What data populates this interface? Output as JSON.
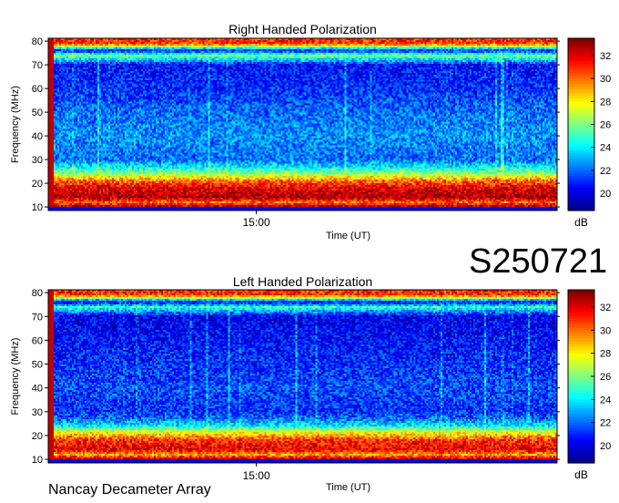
{
  "event_code": "S250721",
  "instrument": "Nancay Decameter Array",
  "colors": {
    "colormap": [
      "#00008f",
      "#0000ff",
      "#0080ff",
      "#00ffff",
      "#80ff80",
      "#ffff00",
      "#ff8000",
      "#ff0000",
      "#800000"
    ]
  },
  "chart_data": [
    {
      "type": "heatmap",
      "title": "Right Handed Polarization",
      "xlabel": "Time (UT)",
      "ylabel": "Frequency (MHz)",
      "x_ticks": [
        "15:00"
      ],
      "y_ticks": [
        10,
        20,
        30,
        40,
        50,
        60,
        70,
        80
      ],
      "ylim": [
        10,
        80
      ],
      "colorbar": {
        "label": "dB",
        "ticks": [
          20,
          22,
          24,
          26,
          28,
          30,
          32
        ],
        "range": [
          18.5,
          33.5
        ]
      },
      "background_level_db": 20.5,
      "frequency_profile_db": [
        {
          "f": 10,
          "db": 33
        },
        {
          "f": 12,
          "db": 30
        },
        {
          "f": 14,
          "db": 33
        },
        {
          "f": 18,
          "db": 32
        },
        {
          "f": 21,
          "db": 30
        },
        {
          "f": 24,
          "db": 26
        },
        {
          "f": 27,
          "db": 24
        },
        {
          "f": 30,
          "db": 22
        },
        {
          "f": 40,
          "db": 22.5
        },
        {
          "f": 50,
          "db": 22
        },
        {
          "f": 60,
          "db": 21
        },
        {
          "f": 70,
          "db": 20.5
        },
        {
          "f": 74,
          "db": 26
        },
        {
          "f": 76,
          "db": 20.5
        },
        {
          "f": 79,
          "db": 31
        }
      ]
    },
    {
      "type": "heatmap",
      "title": "Left Handed Polarization",
      "xlabel": "Time (UT)",
      "ylabel": "Frequency (MHz)",
      "x_ticks": [
        "15:00"
      ],
      "y_ticks": [
        10,
        20,
        30,
        40,
        50,
        60,
        70,
        80
      ],
      "ylim": [
        10,
        80
      ],
      "colorbar": {
        "label": "dB",
        "ticks": [
          20,
          22,
          24,
          26,
          28,
          30,
          32
        ],
        "range": [
          18.5,
          33.5
        ]
      },
      "background_level_db": 20.0,
      "frequency_profile_db": [
        {
          "f": 10,
          "db": 33
        },
        {
          "f": 12,
          "db": 29
        },
        {
          "f": 14,
          "db": 32
        },
        {
          "f": 18,
          "db": 31
        },
        {
          "f": 21,
          "db": 28
        },
        {
          "f": 24,
          "db": 24
        },
        {
          "f": 27,
          "db": 22
        },
        {
          "f": 30,
          "db": 21
        },
        {
          "f": 40,
          "db": 21.5
        },
        {
          "f": 50,
          "db": 21
        },
        {
          "f": 60,
          "db": 20.5
        },
        {
          "f": 70,
          "db": 20
        },
        {
          "f": 74,
          "db": 25
        },
        {
          "f": 76,
          "db": 20
        },
        {
          "f": 79,
          "db": 31
        }
      ]
    }
  ]
}
